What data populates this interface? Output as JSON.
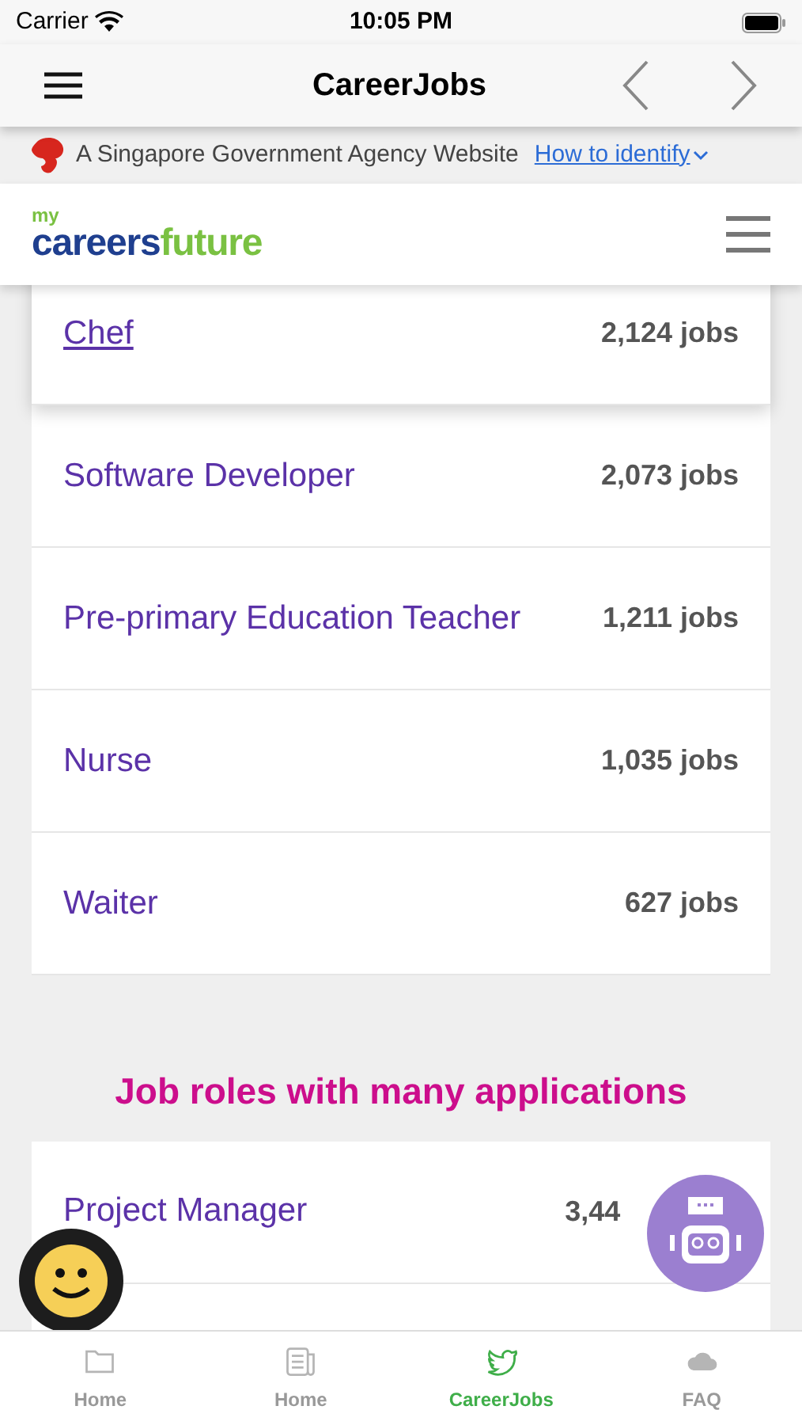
{
  "status_bar": {
    "carrier": "Carrier",
    "time": "10:05 PM"
  },
  "nav": {
    "title": "CareerJobs"
  },
  "gov_banner": {
    "text": "A Singapore Government Agency Website",
    "link": "How to identify"
  },
  "site_header": {
    "logo_small": "my",
    "logo_main": "careers",
    "logo_accent": "future"
  },
  "top_jobs": [
    {
      "role": "Chef",
      "count": "2,124 jobs",
      "selected": true
    },
    {
      "role": "Software Developer",
      "count": "2,073 jobs",
      "selected": false
    },
    {
      "role": "Pre-primary Education Teacher",
      "count": "1,211 jobs",
      "selected": false
    },
    {
      "role": "Nurse",
      "count": "1,035 jobs",
      "selected": false
    },
    {
      "role": "Waiter",
      "count": "627 jobs",
      "selected": false
    }
  ],
  "many_applications": {
    "heading": "Job roles with many applications",
    "rows": [
      {
        "role": "Project Manager",
        "count": "3,44"
      }
    ]
  },
  "tab_bar": [
    {
      "label": "Home",
      "kind": "folder",
      "selected": false
    },
    {
      "label": "Home",
      "kind": "news",
      "selected": false
    },
    {
      "label": "CareerJobs",
      "kind": "bird",
      "selected": true
    },
    {
      "label": "FAQ",
      "kind": "cloud",
      "selected": false
    }
  ]
}
